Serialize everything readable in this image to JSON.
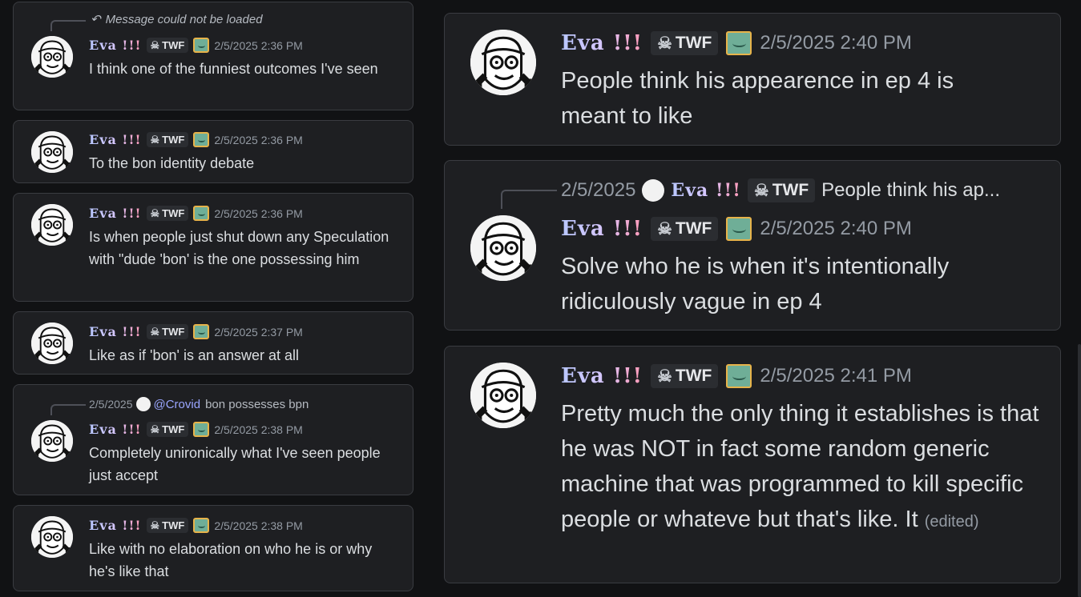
{
  "user": {
    "name": "Eva !!!",
    "tag": "TWF",
    "tag_icon": "skull-icon",
    "decoration": "tv-face-icon"
  },
  "left_messages": [
    {
      "reply_text": "Message could not be loaded",
      "timestamp": "2/5/2025 2:36 PM",
      "text": "I think one of the funniest outcomes I've seen"
    },
    {
      "timestamp": "2/5/2025 2:36 PM",
      "text": "To the bon identity debate"
    },
    {
      "timestamp": "2/5/2025 2:36 PM",
      "text": "Is when people just shut down any Speculation with \"dude 'bon' is the one possessing him"
    },
    {
      "timestamp": "2/5/2025 2:37 PM",
      "text": "Like as if 'bon' is an answer at all"
    },
    {
      "reply_timestamp": "2/5/2025",
      "reply_mention": "@Crovid",
      "reply_text": "bon possesses bpn",
      "timestamp": "2/5/2025 2:38 PM",
      "text": "Completely unironically what I've seen people just accept"
    },
    {
      "timestamp": "2/5/2025 2:38 PM",
      "text": "Like with no elaboration on who he is or why he's like that"
    }
  ],
  "right_messages": [
    {
      "timestamp": "2/5/2025 2:40 PM",
      "text": "People think his appearence in ep 4 is meant to like"
    },
    {
      "reply_timestamp": "2/5/2025",
      "reply_name": "Eva !!!",
      "reply_tag": "TWF",
      "reply_text": "People think his ap...",
      "timestamp": "2/5/2025 2:40 PM",
      "text": "Solve who he is when it's intentionally ridiculously vague in ep 4"
    },
    {
      "timestamp": "2/5/2025 2:41 PM",
      "text": "Pretty much the only thing it establishes is that he was NOT in fact some random generic machine that was programmed to kill specific people or whateve but that's like.  It",
      "edited": "(edited)"
    }
  ],
  "colors": {
    "background": "#111214",
    "card": "#1e1f22",
    "border": "#3a3c41",
    "timestamp": "#949ba4",
    "mention": "#9aa6ff"
  }
}
